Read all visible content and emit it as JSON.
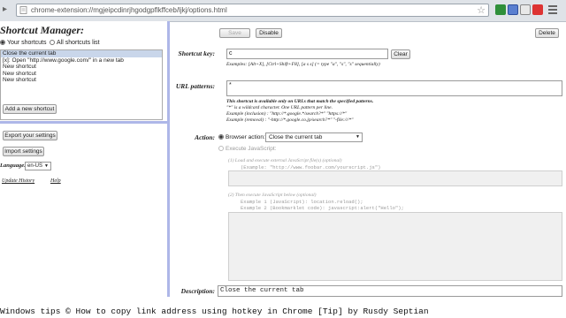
{
  "browser": {
    "url": "chrome-extension://mgjeipcdinrjhgodgpflkffceb/ljkj/options.html"
  },
  "sidebar": {
    "title": "Shortcut Manager:",
    "radio_your": "Your shortcuts",
    "radio_all": "All shortcuts list",
    "shortcuts": [
      "Close the current tab",
      "[x]: Open \"http://www.google.com/\" in a new tab",
      "New shortcut",
      "New shortcut",
      "New shortcut"
    ],
    "add_button": "Add a new shortcut",
    "export_button": "Export your settings",
    "import_button": "Import settings",
    "language_label": "Language:",
    "language_value": "en-US",
    "update_history": "Update History",
    "help": "Help"
  },
  "toolbar": {
    "save": "Save",
    "disable": "Disable",
    "delete": "Delete"
  },
  "form": {
    "shortcut_key_label": "Shortcut key:",
    "shortcut_key_value": "c",
    "clear_button": "Clear",
    "shortcut_examples": "Examples: [Alt+X], [Ctrl+Shift+F8], [a s s] (= type \"a\", \"s\", \"s\" sequentially)",
    "url_patterns_label": "URL patterns:",
    "url_patterns_value": "*",
    "url_note_1": "This shortcut is available only on URLs that match the specified patterns.",
    "url_note_2": "\"*\" is a wildcard character. One URL pattern per line.",
    "url_note_3": "Example (inclusion) : \"http://*.google.*/search?*\"  \"https://*\"",
    "url_note_4": "Example (removal) : \"-http://*.google.co.jp/search?*\"  \"-file:///*\"",
    "action_label": "Action:",
    "browser_action_label": "Browser action:",
    "browser_action_value": "Close the current tab",
    "execute_js_label": "Execute JavaScript:",
    "load_external_label": "(1) Load and execute external JavaScript file(s) (optional)",
    "load_external_example": "(Example: \"http://www.foobar.com/yourscript.js\")",
    "then_execute_label": "(2) Then execute JavaScript below (optional)",
    "then_execute_ex1": "Example 1 (JavaScript): location.reload();",
    "then_execute_ex2": "Example 2 (Bookmarklet code): javascript:alert(\"Hello\");",
    "description_label": "Description:",
    "description_value": "Close the current tab"
  },
  "caption": "Windows tips © How to copy link address using hotkey in Chrome [Tip] by Rusdy Septian"
}
